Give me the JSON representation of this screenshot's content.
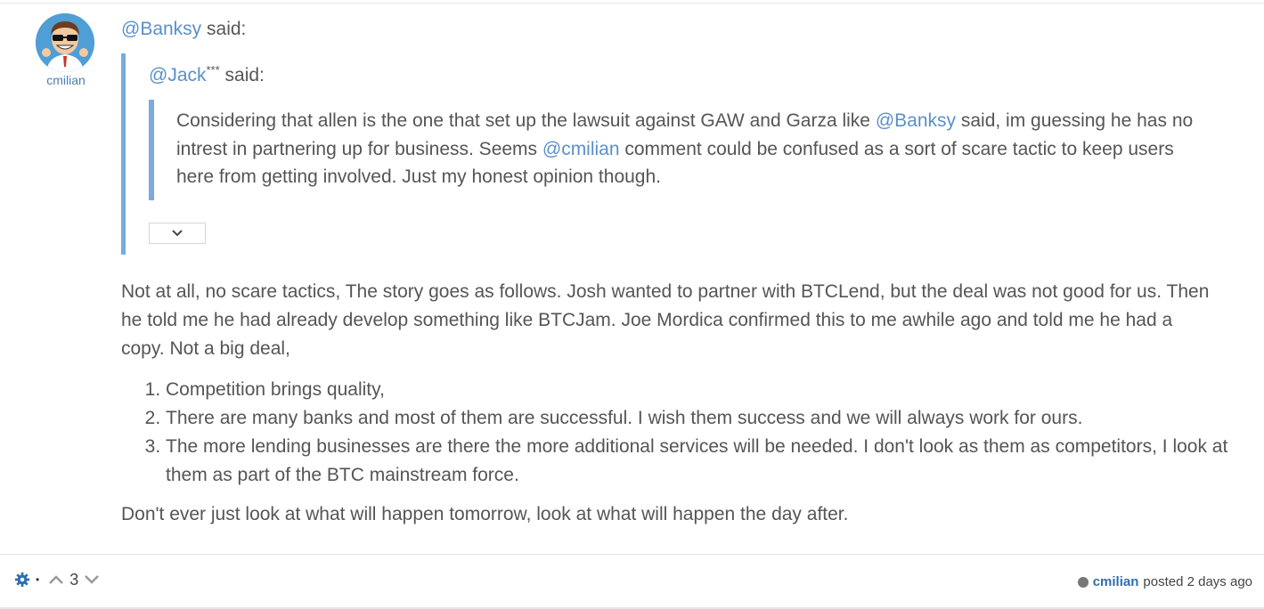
{
  "post": {
    "author": "cmilian",
    "outer_quote_mention": "@Banksy",
    "said": " said:",
    "inner_quote_mention": "@Jack",
    "inner_quote_stars": "***",
    "quote_text": {
      "part1": "Considering that allen is the one that set up the lawsuit against GAW and Garza like ",
      "mention1": "@Banksy",
      "part2": " said, im guessing he has no intrest in partnering up for business. Seems ",
      "mention2": "@cmilian",
      "part3": " comment could be confused as a sort of scare tactic to keep users here from getting involved. Just my honest opinion though."
    },
    "reply_paragraph": "Not at all, no scare tactics, The story goes as follows. Josh wanted to partner with BTCLend, but the deal was not good for us. Then he told me he had already develop something like BTCJam. Joe Mordica confirmed this to me awhile ago and told me he had a copy. Not a big deal,",
    "list_items": [
      "Competition brings quality,",
      "There are many banks and most of them are successful. I wish them success and we will always work for ours.",
      "The more lending businesses are there the more additional services will be needed. I don't look as them as competitors, I look at them as part of the BTC mainstream force."
    ],
    "closing": "Don't ever just look at what will happen tomorrow, look at what will happen the day after."
  },
  "footer": {
    "separator": "•",
    "vote_count": "3",
    "poster": "cmilian",
    "posted_label": "posted",
    "posted_time": "2 days ago"
  },
  "icons": {
    "tools": "gear-icon",
    "upvote": "chevron-up-icon",
    "downvote": "chevron-down-icon",
    "expand": "chevron-down-icon"
  },
  "colors": {
    "link": "#5b8fc9",
    "quote_bar": "#7aaae0",
    "poster_link": "#2f6fb0"
  }
}
